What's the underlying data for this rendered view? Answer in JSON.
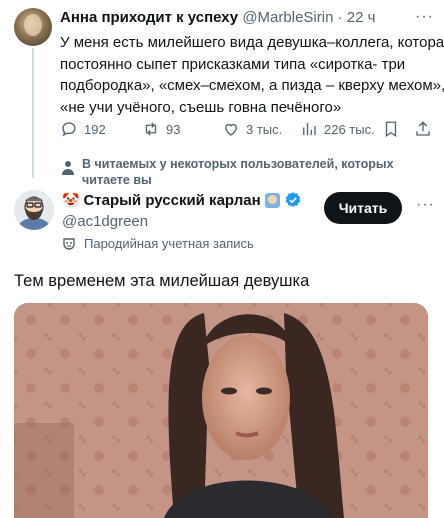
{
  "quoted_tweet": {
    "author_name": "Анна приходит к успеху",
    "author_handle": "@MarbleSirin",
    "separator": "·",
    "time": "22 ч",
    "body_lines": [
      "У меня есть милейшего вида девушка–коллега, которая",
      "постоянно сыпет присказками типа «сиротка- три",
      "подбородка», «смех–смехом, а пизда – кверху мехом»,",
      "«не учи учёного, съешь говна печёного»"
    ],
    "actions": {
      "replies": "192",
      "reposts": "93",
      "likes": "3 тыс.",
      "views": "226 тыс."
    },
    "notice_lines": [
      "В читаемых у некоторых пользователей, которых",
      "читаете вы"
    ]
  },
  "main_tweet": {
    "author_name": "Старый русский карлан",
    "author_handle": "@ac1dgreen",
    "follow_label": "Читать",
    "parody_label": "Пародийная учетная запись",
    "text": "Тем временем эта милейшая девушка"
  },
  "colors": {
    "text": "#0f1419",
    "secondary": "#536471",
    "verified": "#1d9bf0",
    "button_bg": "#0f1419"
  },
  "icons": [
    "reply-icon",
    "repost-icon",
    "like-icon",
    "views-icon",
    "bookmark-icon",
    "person-icon",
    "verified-badge-icon",
    "parody-mask-icon"
  ]
}
